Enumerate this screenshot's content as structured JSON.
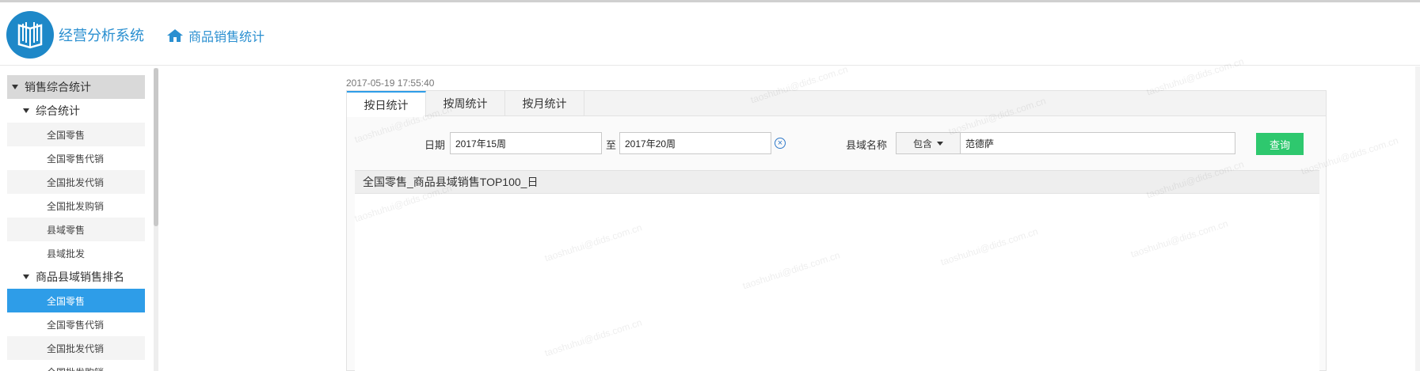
{
  "app": {
    "title": "经营分析系统"
  },
  "breadcrumb": {
    "label": "商品销售统计"
  },
  "sidebar": {
    "items": [
      {
        "label": "销售综合统计",
        "level": 0
      },
      {
        "label": "综合统计",
        "level": 1
      },
      {
        "label": "全国零售",
        "level": 2
      },
      {
        "label": "全国零售代销",
        "level": 2
      },
      {
        "label": "全国批发代销",
        "level": 2
      },
      {
        "label": "全国批发购销",
        "level": 2
      },
      {
        "label": "县域零售",
        "level": 2
      },
      {
        "label": "县域批发",
        "level": 2
      },
      {
        "label": "商品县域销售排名",
        "level": 1
      },
      {
        "label": "全国零售",
        "level": 2,
        "active": true
      },
      {
        "label": "全国零售代销",
        "level": 2
      },
      {
        "label": "全国批发代销",
        "level": 2
      },
      {
        "label": "全国批发购销",
        "level": 2
      }
    ]
  },
  "main": {
    "timestamp": "2017-05-19 17:55:40",
    "tabs": [
      {
        "label": "按日统计",
        "active": true
      },
      {
        "label": "按周统计"
      },
      {
        "label": "按月统计"
      }
    ],
    "filter": {
      "date_label": "日期",
      "date_from": "2017年15周",
      "to_label": "至",
      "date_to": "2017年20周",
      "county_label": "县域名称",
      "match_mode": "包含",
      "county_value": "范德萨",
      "query_label": "查询"
    },
    "result_title": "全国零售_商品县域销售TOP100_日"
  },
  "watermark": "taoshuhui@dids.com.cn",
  "colors": {
    "brand": "#1e88c8",
    "active_menu": "#2e9de8",
    "query_button": "#2ec86e"
  }
}
